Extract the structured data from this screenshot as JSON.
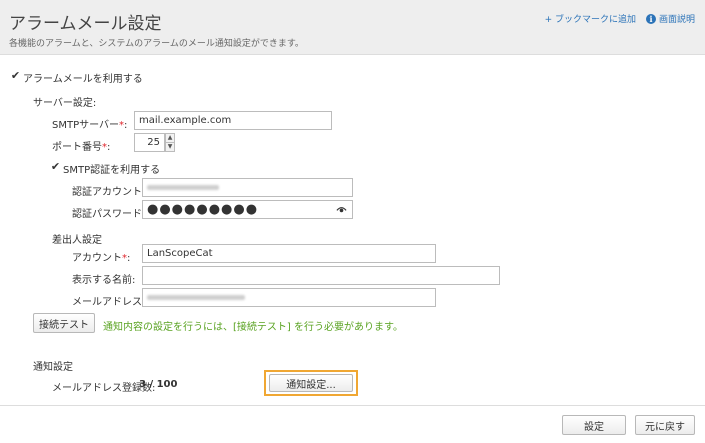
{
  "header": {
    "title": "アラームメール設定",
    "description": "各機能のアラームと、システムのアラームのメール通知設定ができます。",
    "bookmark_link": "+ ブックマークに追加",
    "help_link": "画面説明",
    "help_icon_glyph": "i"
  },
  "alarm_mail": {
    "enable_label": "アラームメールを利用する",
    "checked_glyph": "✔"
  },
  "server": {
    "section_label": "サーバー設定:",
    "smtp_server_label": "SMTPサーバー",
    "smtp_server_value": "mail.example.com",
    "port_label": "ポート番号",
    "port_value": "25",
    "spinner_up": "▲",
    "spinner_down": "▼",
    "smtp_auth_label": "SMTP認証を利用する",
    "auth_account_label": "認証アカウント",
    "auth_password_label": "認証パスワード",
    "auth_password_value": "●●●●●●●●●"
  },
  "sender": {
    "section_label": "差出人設定",
    "account_label": "アカウント",
    "account_value": "LanScopeCat",
    "display_name_label": "表示する名前:",
    "display_name_value": "",
    "mail_address_label": "メールアドレス"
  },
  "required_mark": "*",
  "colon": ":",
  "connection_test": {
    "button_label": "接続テスト",
    "note": "通知内容の設定を行うには、[接続テスト] を行う必要があります。"
  },
  "notification": {
    "section_label": "通知設定",
    "registered_label": "メールアドレス登録数:",
    "registered_value": "3 / 100",
    "settings_button": "通知設定..."
  },
  "footer": {
    "apply_button": "設定",
    "revert_button": "元に戻す"
  }
}
